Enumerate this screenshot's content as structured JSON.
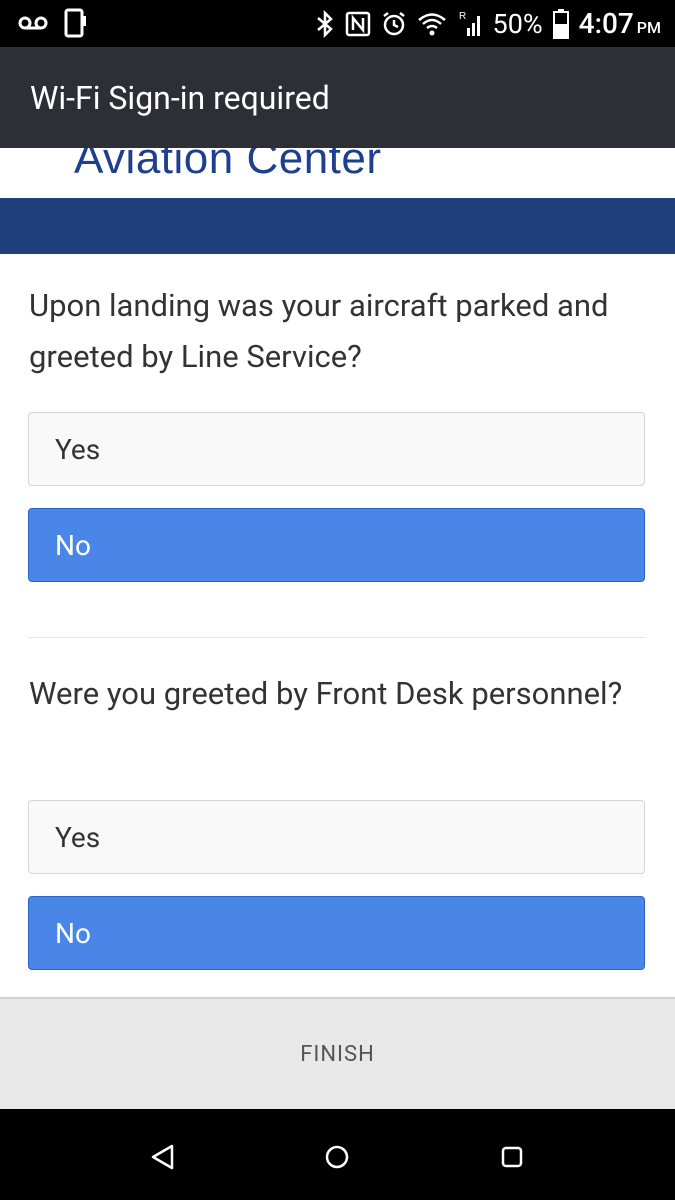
{
  "status_bar": {
    "battery": "50%",
    "time": "4:07",
    "ampm": "PM",
    "icons": [
      "voicemail-icon",
      "phone-outline-icon",
      "bluetooth-icon",
      "nfc-icon",
      "alarm-icon",
      "wifi-icon",
      "signal-icon",
      "battery-icon"
    ]
  },
  "app_bar": {
    "title": "Wi-Fi Sign-in required"
  },
  "logo": {
    "text": "Aviation Center"
  },
  "colors": {
    "accent": "#4a86e8",
    "header": "#2c2f36",
    "band": "#1e3f7b"
  },
  "questions": [
    {
      "text": "Upon landing was your aircraft parked and greeted by Line Service?",
      "options": [
        "Yes",
        "No"
      ],
      "selected": "No"
    },
    {
      "text": "Were you greeted by Front Desk personnel?",
      "options": [
        "Yes",
        "No"
      ],
      "selected": "No"
    }
  ],
  "footer": {
    "finish_label": "FINISH"
  },
  "nav": {
    "icons": [
      "back-icon",
      "home-icon",
      "recents-icon"
    ]
  }
}
